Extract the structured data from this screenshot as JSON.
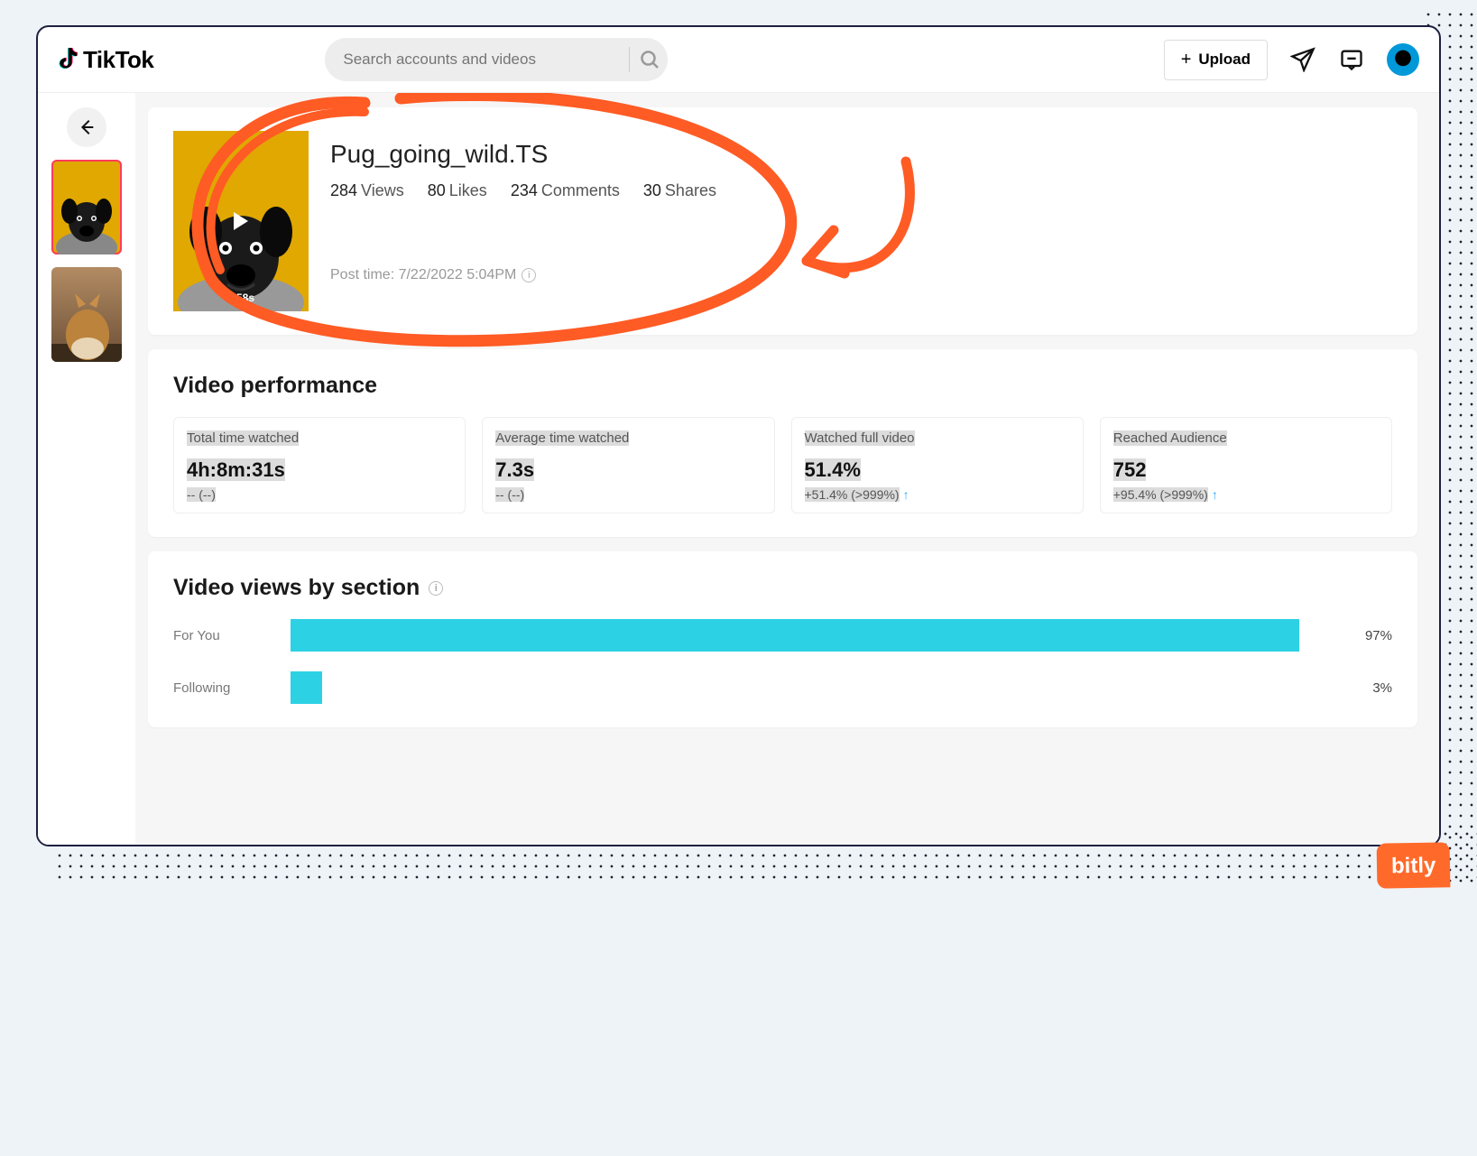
{
  "brand": "TikTok",
  "search": {
    "placeholder": "Search accounts and videos"
  },
  "upload_label": "Upload",
  "sidebar": {
    "thumbs": [
      {
        "name": "thumb-pug",
        "selected": true
      },
      {
        "name": "thumb-cat",
        "selected": false
      }
    ]
  },
  "video": {
    "title": "Pug_going_wild.TS",
    "duration": "7.58s",
    "views": {
      "n": "284",
      "label": "Views"
    },
    "likes": {
      "n": "80",
      "label": "Likes"
    },
    "comments": {
      "n": "234",
      "label": "Comments"
    },
    "shares": {
      "n": "30",
      "label": "Shares"
    },
    "post_time_label": "Post time: 7/22/2022 5:04PM"
  },
  "performance": {
    "title": "Video performance",
    "metrics": [
      {
        "label": "Total time watched",
        "value": "4h:8m:31s",
        "delta": "-- (--)",
        "arrow": false
      },
      {
        "label": "Average time watched",
        "value": "7.3s",
        "delta": "-- (--)",
        "arrow": false
      },
      {
        "label": "Watched full video",
        "value": "51.4%",
        "delta": "+51.4% (>999%)",
        "arrow": true
      },
      {
        "label": "Reached Audience",
        "value": "752",
        "delta": "+95.4% (>999%)",
        "arrow": true
      }
    ]
  },
  "views_by_section": {
    "title": "Video views by section",
    "rows": [
      {
        "label": "For You",
        "pct": 97
      },
      {
        "label": "Following",
        "pct": 3
      }
    ]
  },
  "chart_data": {
    "type": "bar",
    "title": "Video views by section",
    "categories": [
      "For You",
      "Following"
    ],
    "values": [
      97,
      3
    ],
    "xlabel": "",
    "ylabel": "%",
    "ylim": [
      0,
      100
    ]
  },
  "bitly": "bitly"
}
